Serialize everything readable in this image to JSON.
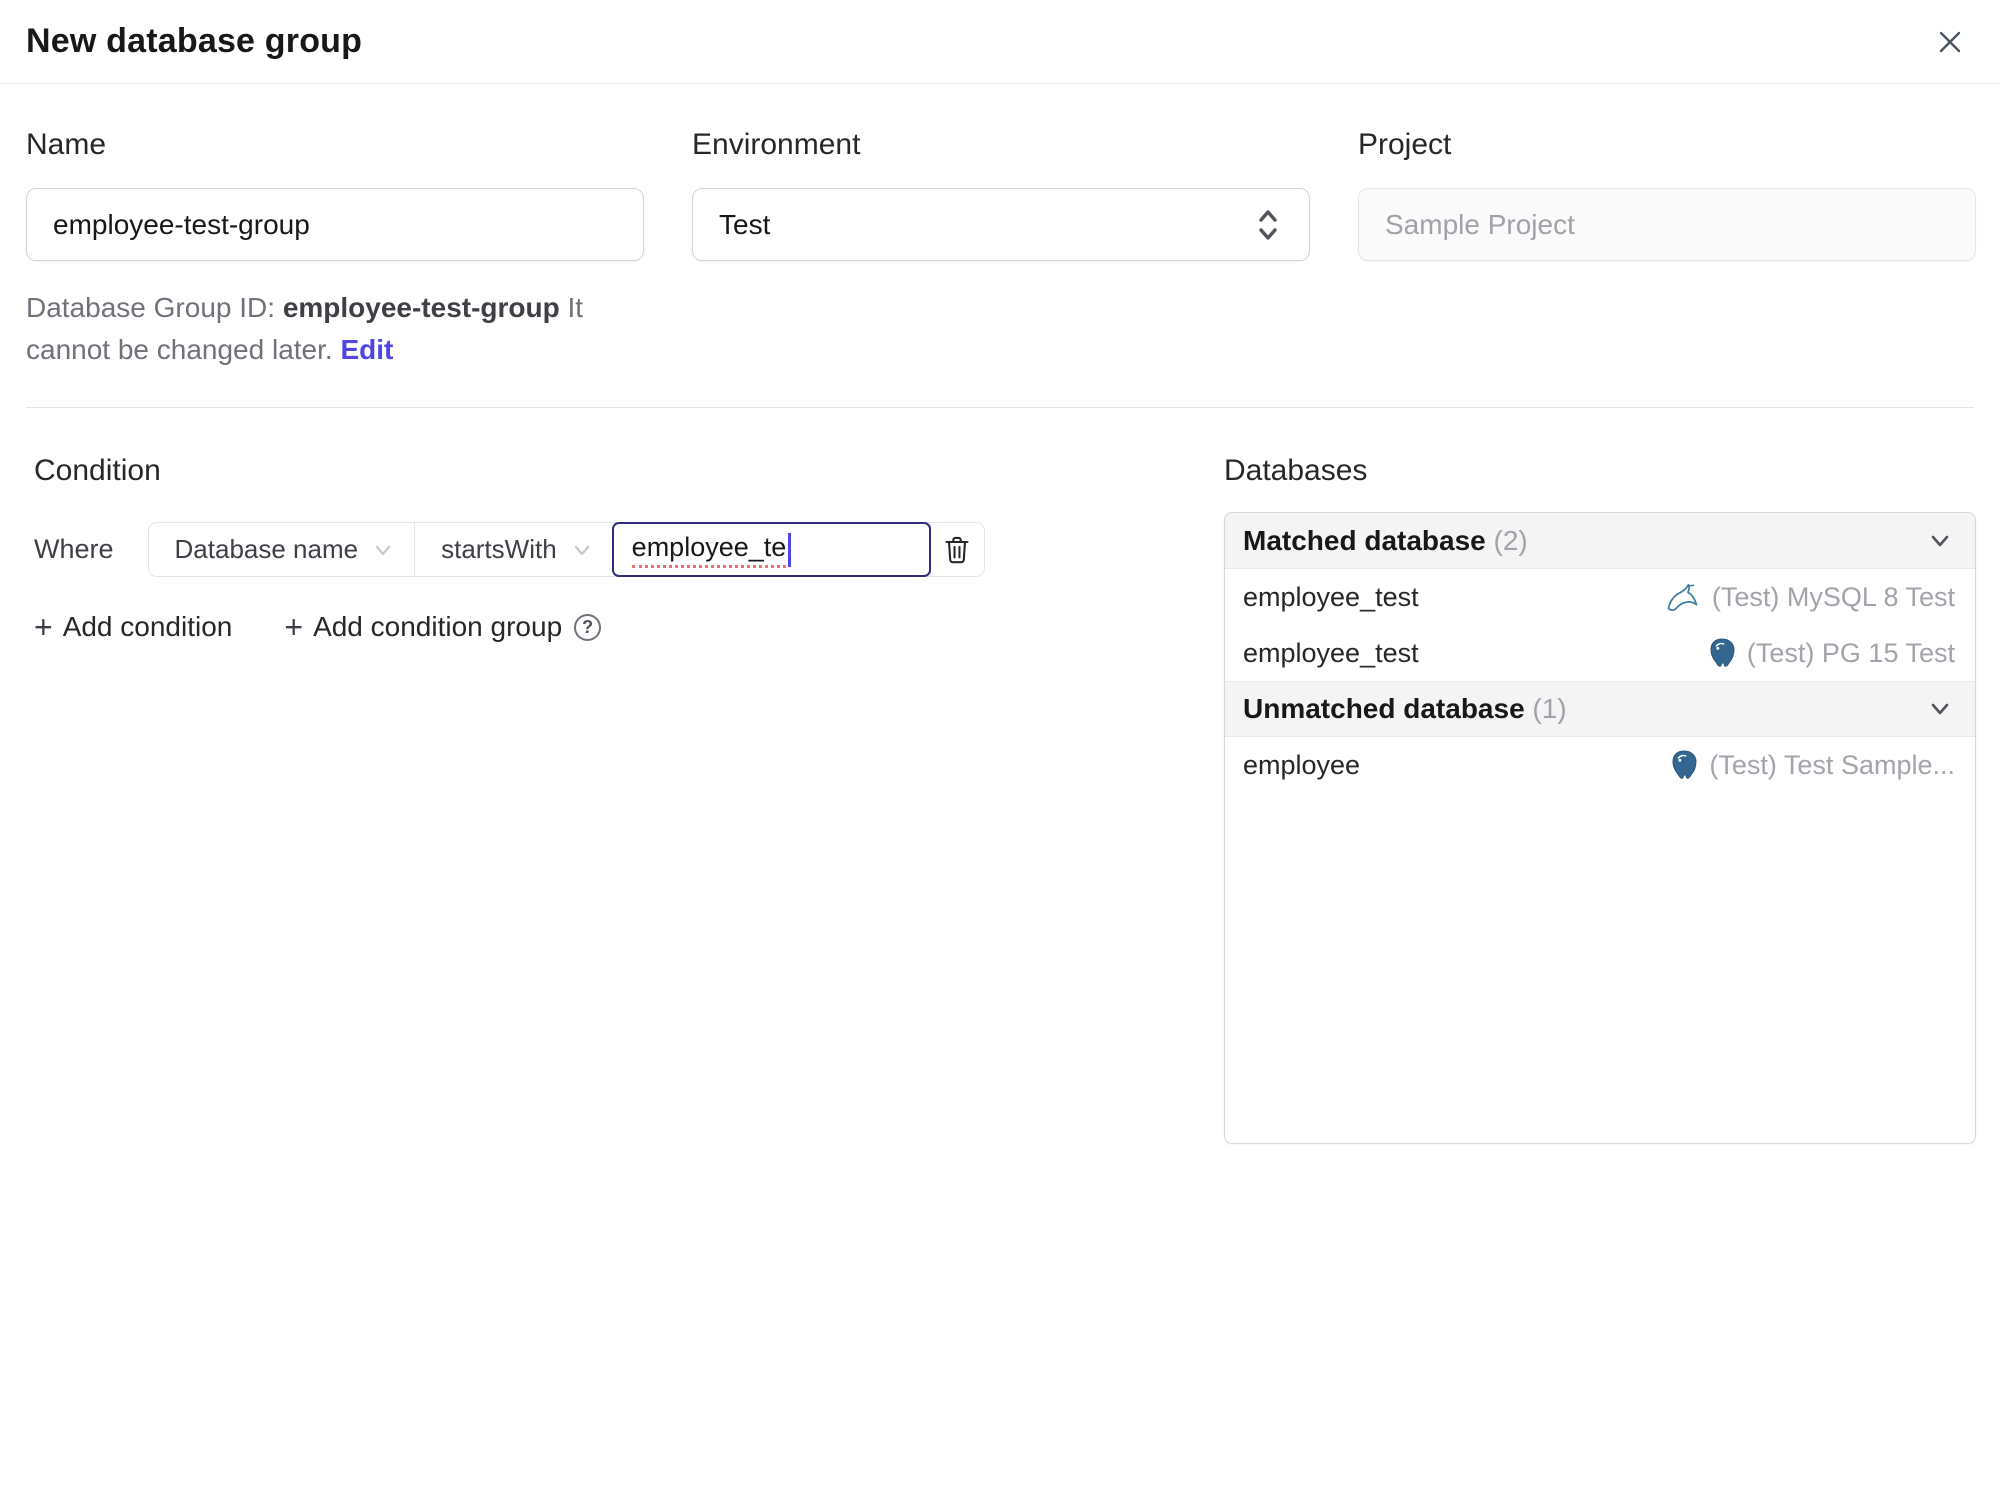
{
  "header": {
    "title": "New database group"
  },
  "form": {
    "name": {
      "label": "Name",
      "value": "employee-test-group"
    },
    "environment": {
      "label": "Environment",
      "value": "Test"
    },
    "project": {
      "label": "Project",
      "value": "Sample Project"
    },
    "id_note": {
      "prefix": "Database Group ID: ",
      "id": "employee-test-group",
      "suffix": " It cannot be changed later. ",
      "edit_label": "Edit"
    }
  },
  "condition": {
    "heading": "Condition",
    "where_label": "Where",
    "field": "Database name",
    "operator": "startsWith",
    "value": "employee_te",
    "add_condition_label": "Add condition",
    "add_condition_group_label": "Add condition group",
    "help_glyph": "?"
  },
  "databases": {
    "heading": "Databases",
    "groups": [
      {
        "label": "Matched database",
        "count": "(2)",
        "rows": [
          {
            "name": "employee_test",
            "engine": "mysql",
            "instance": "(Test) MySQL 8 Test"
          },
          {
            "name": "employee_test",
            "engine": "postgresql",
            "instance": "(Test) PG 15 Test"
          }
        ]
      },
      {
        "label": "Unmatched database",
        "count": "(1)",
        "rows": [
          {
            "name": "employee",
            "engine": "postgresql",
            "instance": "(Test) Test Sample..."
          }
        ]
      }
    ]
  },
  "colors": {
    "accent": "#4f46e5",
    "focus_border": "#312e81",
    "mysql_icon": "#3a7ca0",
    "postgresql_icon": "#336791",
    "panel_header_bg": "#f4f4f5",
    "muted_text": "#a1a1aa"
  }
}
